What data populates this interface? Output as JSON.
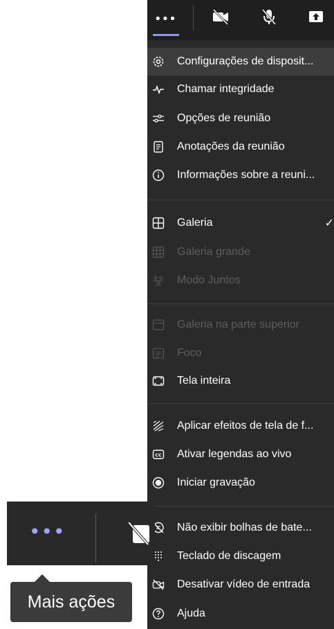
{
  "toolbar_bottom": {
    "tooltip": "Mais ações"
  },
  "menu": {
    "items": [
      {
        "label": "Configurações de disposit...",
        "icon": "gear-icon",
        "disabled": false,
        "checked": false
      },
      {
        "label": "Chamar integridade",
        "icon": "pulse-icon",
        "disabled": false,
        "checked": false
      },
      {
        "label": "Opções de reunião",
        "icon": "sliders-icon",
        "disabled": false,
        "checked": false
      },
      {
        "label": "Anotações da reunião",
        "icon": "notes-icon",
        "disabled": false,
        "checked": false
      },
      {
        "label": "Informações sobre a reuni...",
        "icon": "info-icon",
        "disabled": false,
        "checked": false
      },
      {
        "label": "Galeria",
        "icon": "grid-icon",
        "disabled": false,
        "checked": true
      },
      {
        "label": "Galeria grande",
        "icon": "large-grid-icon",
        "disabled": true,
        "checked": false
      },
      {
        "label": "Modo Juntos",
        "icon": "people-icon",
        "disabled": true,
        "checked": false
      },
      {
        "label": "Galeria na parte superior",
        "icon": "top-gallery-icon",
        "disabled": true,
        "checked": false
      },
      {
        "label": "Foco",
        "icon": "focus-icon",
        "disabled": true,
        "checked": false
      },
      {
        "label": "Tela inteira",
        "icon": "fullscreen-icon",
        "disabled": false,
        "checked": false
      },
      {
        "label": "Aplicar efeitos de tela de f...",
        "icon": "background-effects-icon",
        "disabled": false,
        "checked": false
      },
      {
        "label": "Ativar legendas ao vivo",
        "icon": "cc-icon",
        "disabled": false,
        "checked": false
      },
      {
        "label": "Iniciar gravação",
        "icon": "record-icon",
        "disabled": false,
        "checked": false
      },
      {
        "label": "Não exibir bolhas de bate...",
        "icon": "chat-bubble-off-icon",
        "disabled": false,
        "checked": false
      },
      {
        "label": "Teclado de discagem",
        "icon": "dialpad-icon",
        "disabled": false,
        "checked": false
      },
      {
        "label": "Desativar vídeo de entrada",
        "icon": "video-off-icon",
        "disabled": false,
        "checked": false
      },
      {
        "label": "Ajuda",
        "icon": "help-icon",
        "disabled": false,
        "checked": false
      }
    ]
  },
  "colors": {
    "menu_bg": "#2a2a2a",
    "accent": "#8f97ff",
    "disabled_text": "#5e5e5e"
  }
}
